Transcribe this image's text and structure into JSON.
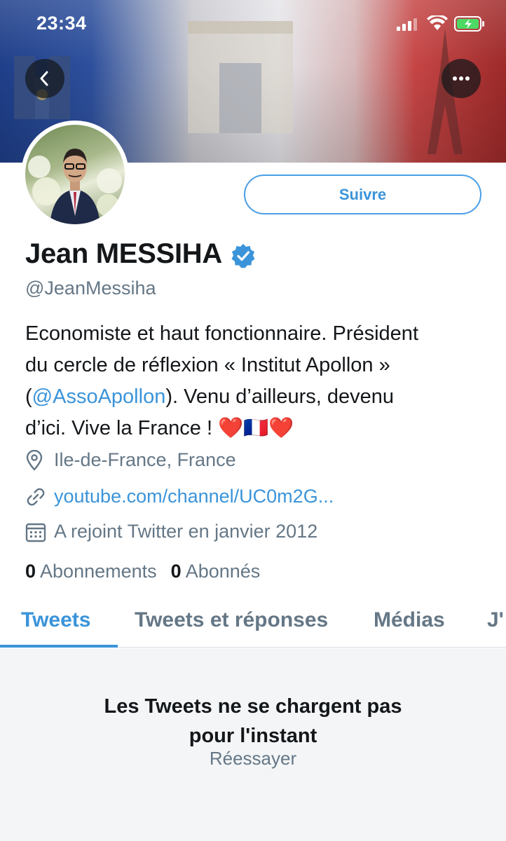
{
  "status_bar": {
    "time": "23:34",
    "icons": [
      "signal-icon",
      "wifi-icon",
      "battery-charging-icon"
    ]
  },
  "header": {
    "back_icon": "chevron-left-icon",
    "more_icon": "more-horizontal-icon"
  },
  "profile": {
    "follow_label": "Suivre",
    "name": "Jean MESSIHA",
    "verified": true,
    "handle": "@JeanMessiha",
    "bio": {
      "line1": "Economiste et haut fonctionnaire. Président",
      "line2": "du cercle de réflexion « Institut Apollon »",
      "line3_open": "(",
      "line3_mention": "@AssoApollon",
      "line3_rest": "). Venu d’ailleurs, devenu",
      "line4": "d’ici. Vive la France ! ",
      "emoji_heart": "❤️",
      "emoji_flag": "🇫🇷"
    },
    "location": "Ile-de-France, France",
    "link": "youtube.com/channel/UC0m2G...",
    "joined": "A rejoint Twitter en janvier 2012",
    "following_count": "0",
    "following_label": "Abonnements",
    "followers_count": "0",
    "followers_label": "Abonnés"
  },
  "tabs": [
    {
      "label": "Tweets",
      "active": true
    },
    {
      "label": "Tweets et réponses",
      "active": false
    },
    {
      "label": "Médias",
      "active": false
    },
    {
      "label": "J'",
      "active": false
    }
  ],
  "timeline": {
    "error_line1": "Les Tweets ne se chargent pas",
    "error_line2": "pour l'instant",
    "retry_label": "Réessayer"
  },
  "colors": {
    "accent": "#3b94d9",
    "secondary_text": "#657786",
    "primary_text": "#14171a"
  }
}
